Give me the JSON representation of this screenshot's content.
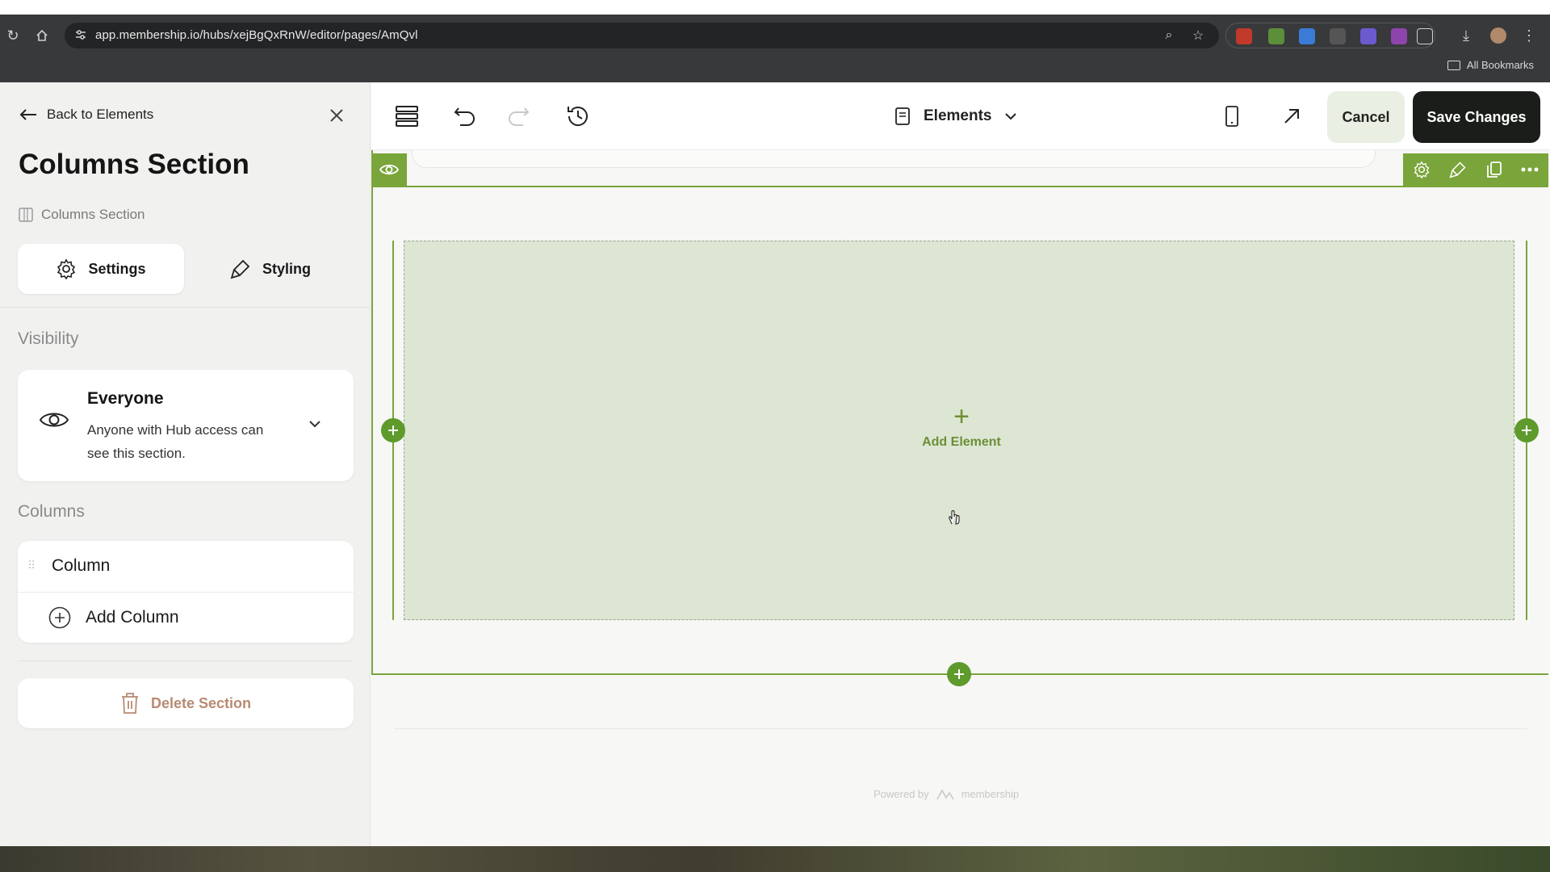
{
  "browser": {
    "url": "app.membership.io/hubs/xejBgQxRnW/editor/pages/AmQvl",
    "bookmarks_label": "All Bookmarks"
  },
  "panel": {
    "back_label": "Back to Elements",
    "title": "Columns Section",
    "breadcrumb": "Columns Section",
    "tabs": [
      {
        "label": "Settings",
        "active": true
      },
      {
        "label": "Styling",
        "active": false
      }
    ],
    "visibility": {
      "section_label": "Visibility",
      "title": "Everyone",
      "description": "Anyone with Hub access can see this section."
    },
    "columns": {
      "section_label": "Columns",
      "items": [
        "Column"
      ],
      "add_label": "Add Column"
    },
    "delete_label": "Delete Section"
  },
  "toolbar": {
    "page_selector": "Elements",
    "cancel_label": "Cancel",
    "save_label": "Save Changes"
  },
  "canvas": {
    "add_element_label": "Add Element",
    "powered_by": "Powered by",
    "brand": "membership"
  },
  "colors": {
    "accent_green": "#7aa53a",
    "column_fill": "#dde6d3",
    "save_button": "#1a1d19",
    "delete_text": "#b88a72"
  }
}
